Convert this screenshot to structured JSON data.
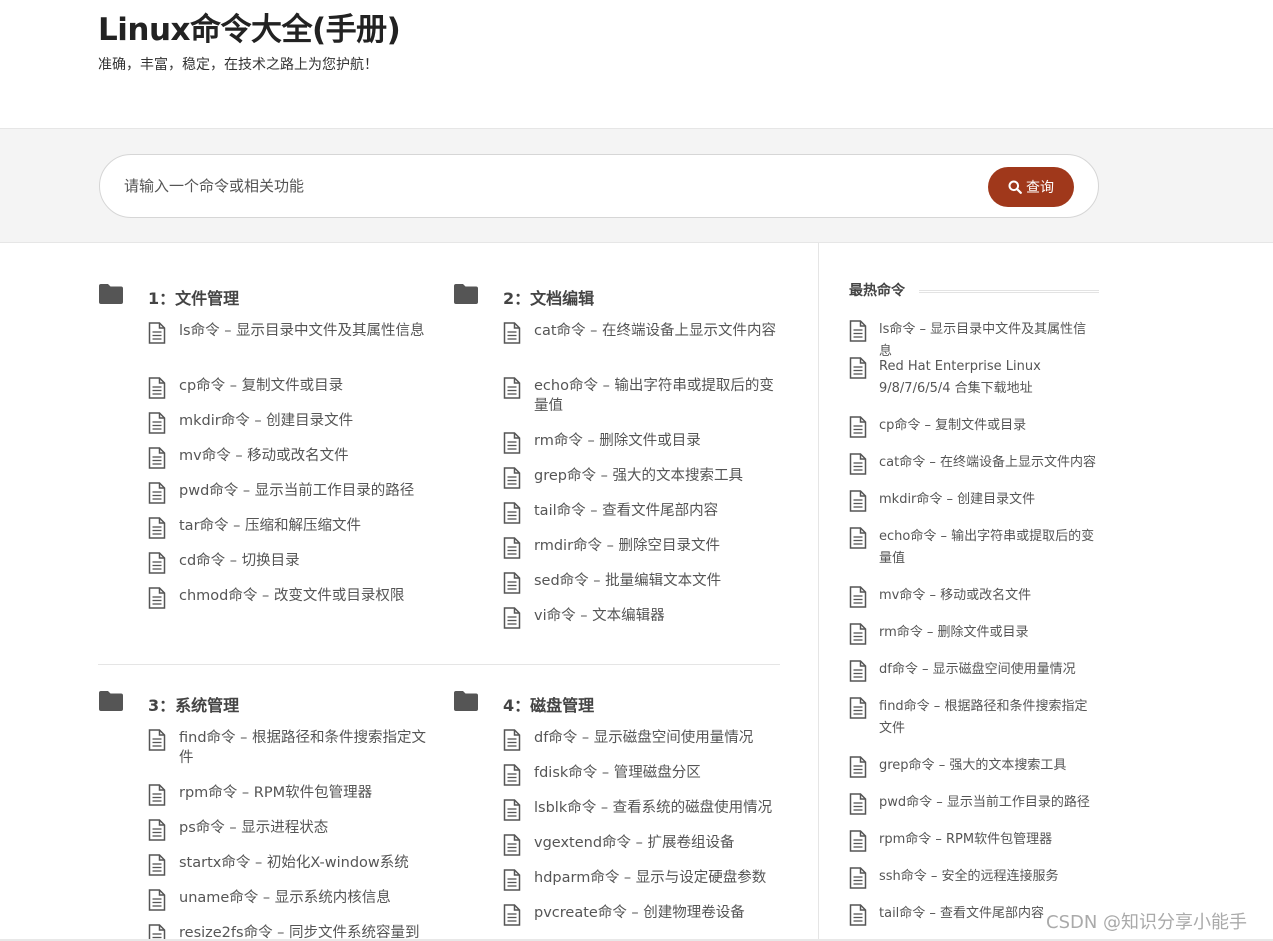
{
  "header": {
    "title": "Linux命令大全(手册)",
    "tagline": "准确，丰富，稳定，在技术之路上为您护航！"
  },
  "search": {
    "placeholder": "请输入一个命令或相关功能",
    "button_label": "查询"
  },
  "sections": [
    {
      "title": "1：文件管理",
      "items": [
        "ls命令 – 显示目录中文件及其属性信息",
        "cp命令 – 复制文件或目录",
        "mkdir命令 – 创建目录文件",
        "mv命令 – 移动或改名文件",
        "pwd命令 – 显示当前工作目录的路径",
        "tar命令 – 压缩和解压缩文件",
        "cd命令 – 切换目录",
        "chmod命令 – 改变文件或目录权限"
      ]
    },
    {
      "title": "2：文档编辑",
      "items": [
        "cat命令 – 在终端设备上显示文件内容",
        "echo命令 – 输出字符串或提取后的变量值",
        "rm命令 – 删除文件或目录",
        "grep命令 – 强大的文本搜索工具",
        "tail命令 – 查看文件尾部内容",
        "rmdir命令 – 删除空目录文件",
        "sed命令 – 批量编辑文本文件",
        "vi命令 – 文本编辑器"
      ]
    },
    {
      "title": "3：系统管理",
      "items": [
        "find命令 – 根据路径和条件搜索指定文件",
        "rpm命令 – RPM软件包管理器",
        "ps命令 – 显示进程状态",
        "startx命令 – 初始化X-window系统",
        "uname命令 – 显示系统内核信息",
        "resize2fs命令 – 同步文件系统容量到"
      ]
    },
    {
      "title": "4：磁盘管理",
      "items": [
        "df命令 – 显示磁盘空间使用量情况",
        "fdisk命令 – 管理磁盘分区",
        "lsblk命令 – 查看系统的磁盘使用情况",
        "vgextend命令 – 扩展卷组设备",
        "hdparm命令 – 显示与设定硬盘参数",
        "pvcreate命令 – 创建物理卷设备"
      ]
    }
  ],
  "sidebar": {
    "title": "最热命令",
    "items": [
      "ls命令 – 显示目录中文件及其属性信息",
      "Red Hat Enterprise Linux 9/8/7/6/5/4 合集下载地址",
      "cp命令 – 复制文件或目录",
      "cat命令 – 在终端设备上显示文件内容",
      "mkdir命令 – 创建目录文件",
      "echo命令 – 输出字符串或提取后的变量值",
      "mv命令 – 移动或改名文件",
      "rm命令 – 删除文件或目录",
      "df命令 – 显示磁盘空间使用量情况",
      "find命令 – 根据路径和条件搜索指定文件",
      "grep命令 – 强大的文本搜索工具",
      "pwd命令 – 显示当前工作目录的路径",
      "rpm命令 – RPM软件包管理器",
      "ssh命令 – 安全的远程连接服务",
      "tail命令 – 查看文件尾部内容"
    ]
  },
  "watermark": "CSDN @知识分享小能手",
  "colors": {
    "accent": "#a0381b",
    "band": "#f4f4f4",
    "icon": "#555555"
  },
  "icons": {
    "section": "folder-icon",
    "item": "document-icon",
    "search": "search-icon"
  }
}
